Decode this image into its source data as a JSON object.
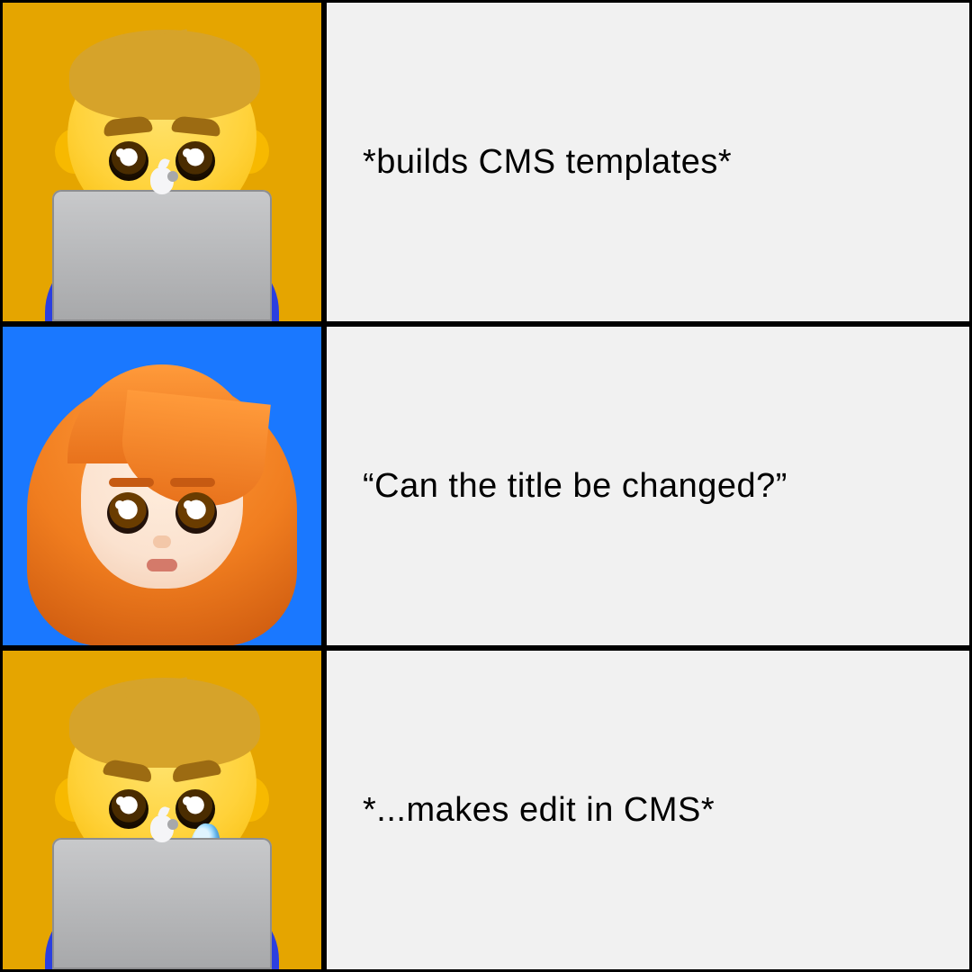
{
  "panels": [
    {
      "image_bg": "#e5a500",
      "persona": "man-technologist",
      "caption": "*builds CMS templates*"
    },
    {
      "image_bg": "#1a78ff",
      "persona": "woman-red-hair",
      "caption": "“Can the title be changed?”"
    },
    {
      "image_bg": "#e5a500",
      "persona": "man-technologist-crying",
      "caption": "*...makes edit in CMS*"
    }
  ]
}
